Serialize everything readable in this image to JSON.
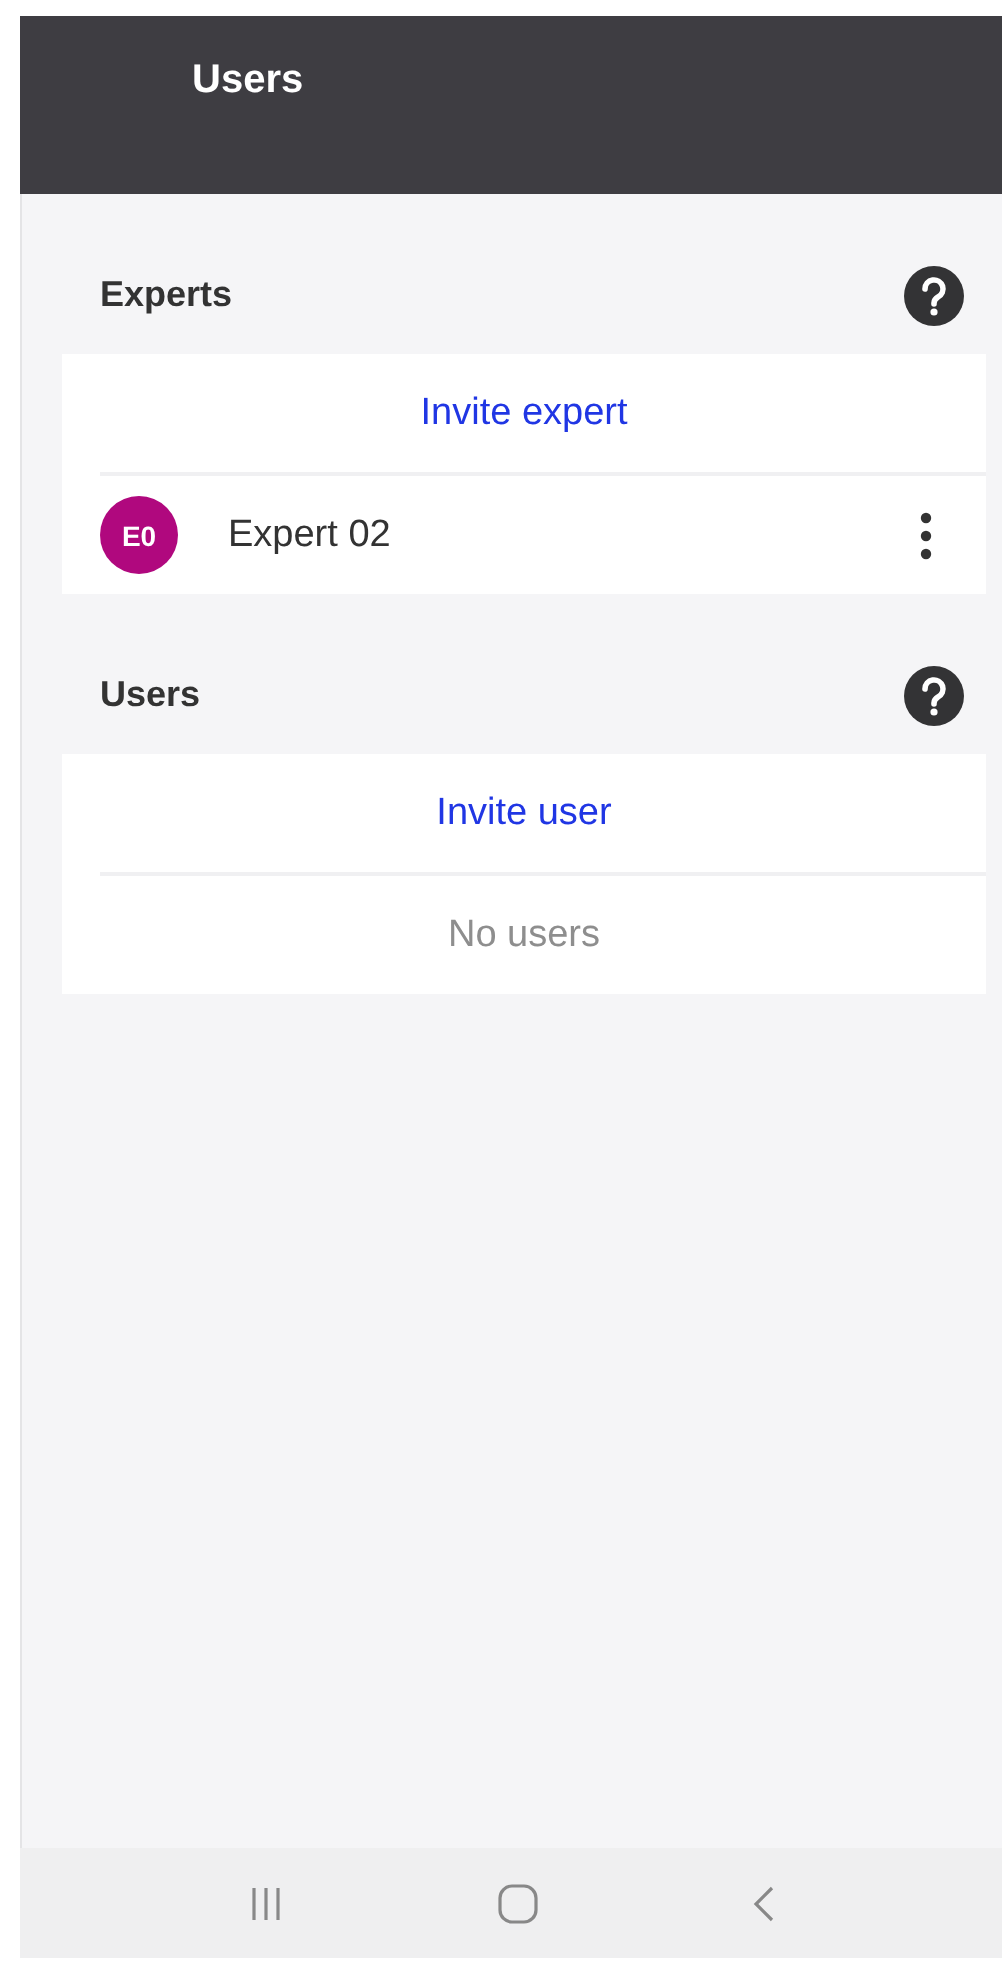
{
  "header": {
    "title": "Users"
  },
  "sections": [
    {
      "title": "Experts",
      "invite_label": "Invite expert",
      "items": [
        {
          "initials": "E0",
          "name": "Expert 02",
          "color": "#b0087e"
        }
      ]
    },
    {
      "title": "Users",
      "invite_label": "Invite user",
      "empty_text": "No users"
    }
  ]
}
